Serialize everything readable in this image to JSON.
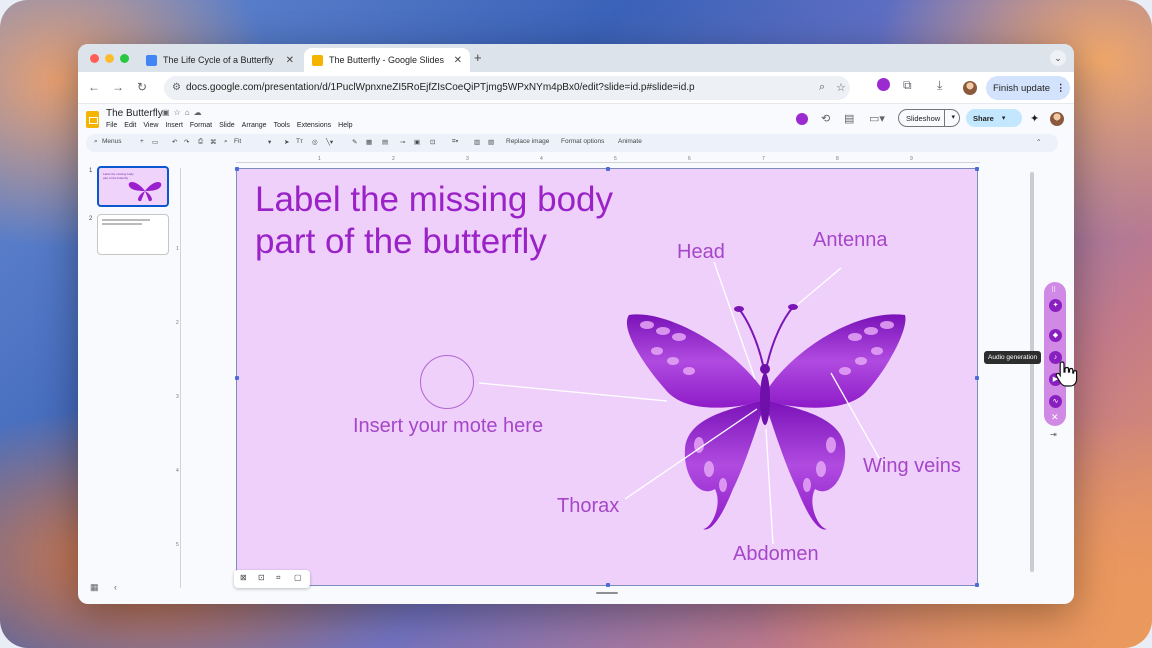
{
  "browser": {
    "tabs": [
      {
        "label": "The Life Cycle of a Butterfly",
        "active": false
      },
      {
        "label": "The Butterfly - Google Slides",
        "active": true
      }
    ],
    "url": "docs.google.com/presentation/d/1PuclWpnxneZI5RoEjfZIsCoeQiPTjmg5WPxNYm4pBx0/edit?slide=id.p#slide=id.p",
    "finish_update_label": "Finish update"
  },
  "document": {
    "title": "The Butterfly",
    "menus": [
      "File",
      "Edit",
      "View",
      "Insert",
      "Format",
      "Slide",
      "Arrange",
      "Tools",
      "Extensions",
      "Help"
    ],
    "slideshow_label": "Slideshow",
    "share_label": "Share"
  },
  "toolbar": {
    "menus_label": "Menus",
    "zoom_label": "Fit",
    "replace_image": "Replace image",
    "format_options": "Format options",
    "animate": "Animate"
  },
  "filmstrip": {
    "slides": [
      {
        "number": "1",
        "text": "Label the missing body part of the butterfly",
        "active": true
      },
      {
        "number": "2",
        "text": "",
        "active": false
      }
    ]
  },
  "ruler": {
    "h_ticks": [
      "1",
      "2",
      "3",
      "4",
      "5",
      "6",
      "7",
      "8",
      "9"
    ],
    "v_ticks": [
      "1",
      "2",
      "3",
      "4",
      "5"
    ]
  },
  "slide": {
    "title": "Label the missing body part of the butterfly",
    "labels": {
      "head": "Head",
      "antenna": "Antenna",
      "insert": "Insert your mote here",
      "wing_veins": "Wing veins",
      "thorax": "Thorax",
      "abdomen": "Abdomen"
    },
    "colors": {
      "background": "#eed0fb",
      "title": "#9a22c6",
      "wing": "#9b1fcf"
    }
  },
  "side_panel": {
    "tooltip": "Audio generation"
  }
}
